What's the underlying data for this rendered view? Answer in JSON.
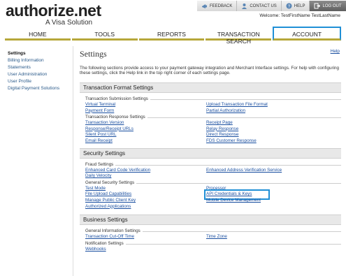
{
  "logo": {
    "main": "authorize.net",
    "sub": "A Visa Solution"
  },
  "utility": [
    {
      "label": "FEEDBACK",
      "icon": "feedback-icon"
    },
    {
      "label": "CONTACT US",
      "icon": "contact-icon"
    },
    {
      "label": "HELP",
      "icon": "help-icon"
    },
    {
      "label": "LOG OUT",
      "icon": "logout-icon"
    }
  ],
  "welcome": "Welcome: TestFirstName TestLastName",
  "nav": [
    {
      "label": "HOME"
    },
    {
      "label": "TOOLS"
    },
    {
      "label": "REPORTS"
    },
    {
      "label": "TRANSACTION SEARCH"
    },
    {
      "label": "ACCOUNT"
    }
  ],
  "sidebar": [
    {
      "label": "Settings"
    },
    {
      "label": "Billing Information"
    },
    {
      "label": "Statements"
    },
    {
      "label": "User Administration"
    },
    {
      "label": "User Profile"
    },
    {
      "label": "Digital Payment Solutions"
    }
  ],
  "main": {
    "title": "Settings",
    "help": "Help",
    "intro": "The following sections provide access to your payment gateway integration and Merchant Interface settings. For help with configuring these settings, click the Help link in the top right corner of each settings page."
  },
  "sections": {
    "transaction_format": {
      "title": "Transaction Format Settings",
      "submission_title": "Transaction Submission Settings",
      "submission_links": [
        "Virtual Terminal",
        "Upload Transaction File Format",
        "Payment Form",
        "Partial Authorization"
      ],
      "response_title": "Transaction Response Settings",
      "response_links": [
        "Transaction Version",
        "Receipt Page",
        "Response/Receipt URLs",
        "Relay Response",
        "Silent Post URL",
        "Direct Response",
        "Email Receipt",
        "FDS Customer Response"
      ]
    },
    "security": {
      "title": "Security Settings",
      "fraud_title": "Fraud Settings",
      "fraud_links": [
        "Enhanced Card Code Verification",
        "Enhanced Address Verification Service",
        "Daily Velocity"
      ],
      "general_title": "General Security Settings",
      "general_links": [
        "Test Mode",
        "Processor",
        "File Upload Capabilities",
        "API Credentials & Keys",
        "Manage Public Client Key",
        "Mobile Device Management",
        "Authorized Applications"
      ]
    },
    "business": {
      "title": "Business Settings",
      "general_title": "General Information Settings",
      "general_links": [
        "Transaction Cut-Off Time",
        "Time Zone"
      ],
      "notification_title": "Notification Settings",
      "notification_links": [
        "Webhooks"
      ]
    }
  }
}
